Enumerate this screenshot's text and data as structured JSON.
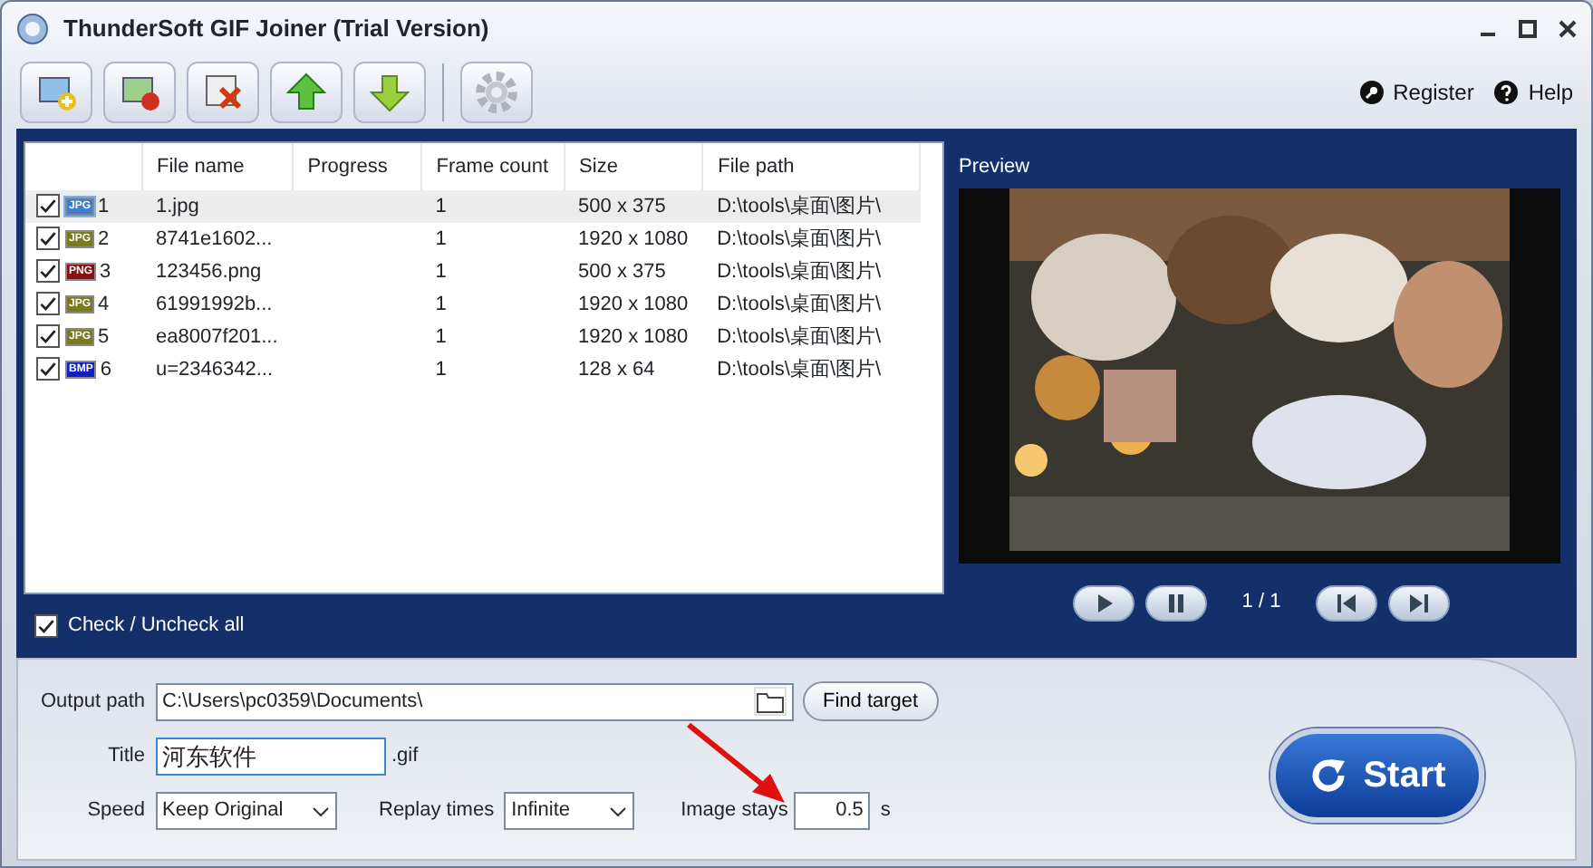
{
  "window": {
    "title": "ThunderSoft GIF Joiner (Trial Version)"
  },
  "header_links": [
    {
      "kind": "register",
      "label": "Register"
    },
    {
      "kind": "help",
      "label": "Help"
    }
  ],
  "file_table": {
    "columns": [
      "File name",
      "Progress",
      "Frame count",
      "Size",
      "File path"
    ],
    "rows": [
      {
        "checked": true,
        "selected": true,
        "type_label": "JPG",
        "color": "#3a7fd0",
        "number": "1",
        "file_name": "1.jpg",
        "frame_count": "1",
        "size": "500 x 375",
        "file_path": "D:\\tools\\桌面\\图片\\"
      },
      {
        "checked": true,
        "selected": false,
        "type_label": "JPG",
        "color": "#7a7a1e",
        "number": "2",
        "file_name": "8741e1602...",
        "frame_count": "1",
        "size": "1920 x 1080",
        "file_path": "D:\\tools\\桌面\\图片\\"
      },
      {
        "checked": true,
        "selected": false,
        "type_label": "PNG",
        "color": "#8a1010",
        "number": "3",
        "file_name": "123456.png",
        "frame_count": "1",
        "size": "500 x 375",
        "file_path": "D:\\tools\\桌面\\图片\\"
      },
      {
        "checked": true,
        "selected": false,
        "type_label": "JPG",
        "color": "#7a7a1e",
        "number": "4",
        "file_name": "61991992b...",
        "frame_count": "1",
        "size": "1920 x 1080",
        "file_path": "D:\\tools\\桌面\\图片\\"
      },
      {
        "checked": true,
        "selected": false,
        "type_label": "JPG",
        "color": "#7a7a1e",
        "number": "5",
        "file_name": "ea8007f201...",
        "frame_count": "1",
        "size": "1920 x 1080",
        "file_path": "D:\\tools\\桌面\\图片\\"
      },
      {
        "checked": true,
        "selected": false,
        "type_label": "BMP",
        "color": "#1020c0",
        "number": "6",
        "file_name": "u=2346342...",
        "frame_count": "1",
        "size": "128 x 64",
        "file_path": "D:\\tools\\桌面\\图片\\"
      }
    ]
  },
  "check_all": {
    "label": "Check / Uncheck all",
    "checked": true
  },
  "preview": {
    "title": "Preview",
    "counter": "1 / 1"
  },
  "output": {
    "output_path_label": "Output path",
    "output_path": "C:\\Users\\pc0359\\Documents\\",
    "find_target": "Find target",
    "title_label": "Title",
    "title_value": "河东软件",
    "title_suffix": ".gif",
    "speed_label": "Speed",
    "speed_value": "Keep Original",
    "replay_label": "Replay times",
    "replay_value": "Infinite",
    "image_stays_label": "Image stays",
    "image_stays_value": "0.5",
    "image_stays_unit": "s"
  },
  "start_button": "Start"
}
